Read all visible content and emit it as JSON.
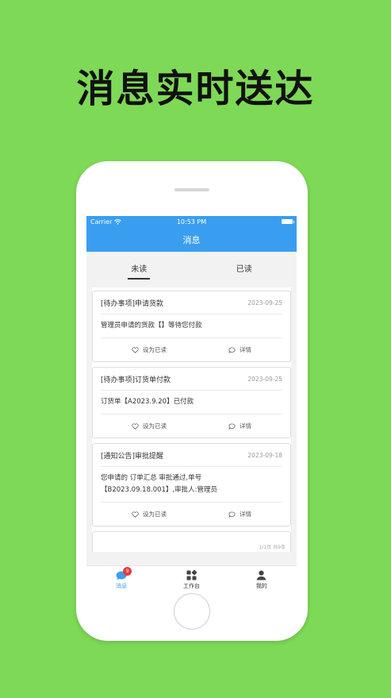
{
  "headline": "消息实时送达",
  "status_bar": {
    "carrier": "Carrier",
    "time": "10:53 PM"
  },
  "nav": {
    "title": "消息"
  },
  "tabs": [
    {
      "label": "未读",
      "active": true
    },
    {
      "label": "已读",
      "active": false
    }
  ],
  "messages": [
    {
      "title": "[待办事项]申请货款",
      "date": "2023-09-25",
      "body": "管理员申请的货款【】等待您付款",
      "mark_read": "设为已读",
      "details": "详情"
    },
    {
      "title": "[待办事项]订货单付款",
      "date": "2023-09-25",
      "body": "订货单【A2023.9.20】已付款",
      "mark_read": "设为已读",
      "details": "详情"
    },
    {
      "title": "[通知公告]审批提醒",
      "date": "2023-09-18",
      "body_line1": "您申请的 订单汇总 审批通过,单号",
      "body_line2": "【B2023.09.18.001】,审批人:管理员",
      "mark_read": "设为已读",
      "details": "详情"
    }
  ],
  "pager": "1/1页 共9条",
  "tabbar": [
    {
      "label": "消息",
      "icon": "chat-bubble-icon",
      "badge": "9",
      "active": true
    },
    {
      "label": "工作台",
      "icon": "grid-icon",
      "active": false
    },
    {
      "label": "我的",
      "icon": "user-icon",
      "active": false
    }
  ],
  "colors": {
    "background": "#7ed957",
    "accent": "#3a9ef0",
    "badge": "#e83a3a"
  }
}
